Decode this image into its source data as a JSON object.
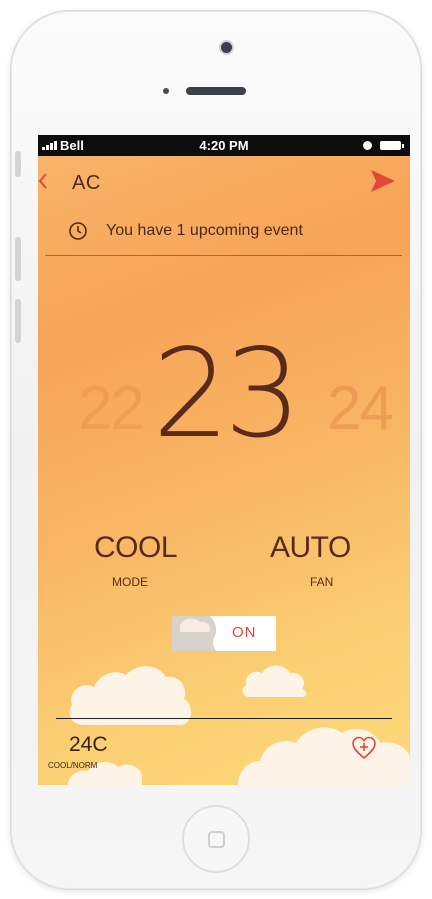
{
  "statusbar": {
    "carrier": "Bell",
    "time": "4:20 PM"
  },
  "header": {
    "title": "AC"
  },
  "notice": {
    "text": "You have 1 upcoming event"
  },
  "temperature": {
    "previous": "22",
    "current": "23",
    "next": "24"
  },
  "mode": {
    "value": "COOL",
    "label": "MODE"
  },
  "fan": {
    "value": "AUTO",
    "label": "FAN"
  },
  "power": {
    "label": "ON",
    "state": "on"
  },
  "footer": {
    "setpoint": "24C",
    "setpoint_mode": "COOL/NORM"
  },
  "colors": {
    "accent": "#e2473a",
    "text": "#5a2a1a",
    "background_top": "#f7a457",
    "background_bottom": "#fcd97a"
  },
  "icons": {
    "back": "chevron-left-icon",
    "send": "send-arrow-icon",
    "event": "clock-icon",
    "favorite": "heart-plus-icon",
    "signal": "signal-bars-icon",
    "alarm": "alarm-icon",
    "battery": "battery-icon"
  }
}
